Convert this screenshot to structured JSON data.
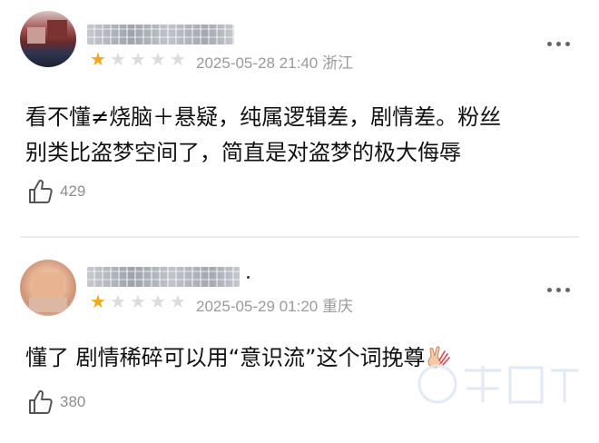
{
  "comments": [
    {
      "rating": 1,
      "max_rating": 5,
      "date": "2025-05-28 21:40",
      "location": "浙江",
      "text_line1": "看不懂≠烧脑＋悬疑，纯属逻辑差，剧情差。粉丝",
      "text_line2": "别类比盗梦空间了，简直是对盗梦的极大侮辱",
      "likes": "429"
    },
    {
      "rating": 1,
      "max_rating": 5,
      "date": "2025-05-29 01:20",
      "location": "重庆",
      "text_line1": "懂了 剧情稀碎可以用“意识流”这个词挽尊",
      "likes": "380"
    }
  ],
  "colors": {
    "star_on": "#f1a81c",
    "star_off": "#dcdcdc",
    "meta_text": "#9a9a9a",
    "divider": "#ececec"
  },
  "icons": {
    "like": "thumbs-up-icon",
    "more": "more-dots-icon",
    "emoji": "victory-hand-emoji"
  }
}
